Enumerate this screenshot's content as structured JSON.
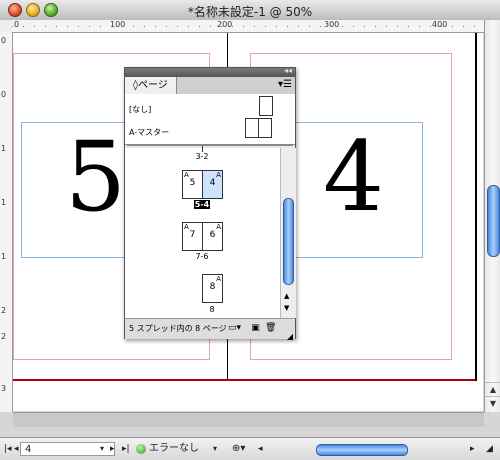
{
  "window": {
    "title": "*名称未設定-1 @ 50%"
  },
  "rulers": {
    "top_labels": [
      "0",
      "100",
      "200",
      "300",
      "400"
    ],
    "left_labels": [
      "0",
      "0",
      "1",
      "1",
      "1",
      "2",
      "2",
      "3"
    ]
  },
  "document": {
    "left_page_number": "5",
    "right_page_number": "4"
  },
  "pages_panel": {
    "tab_label": "◊ページ",
    "masters": [
      {
        "label": "[なし]"
      },
      {
        "label": "A-マスター"
      }
    ],
    "spreads": [
      {
        "label": "3-2",
        "pages": []
      },
      {
        "label": "5-4",
        "pages": [
          {
            "master": "A",
            "number": "5"
          },
          {
            "master": "A",
            "number": "4"
          }
        ]
      },
      {
        "label": "7-6",
        "pages": [
          {
            "master": "A",
            "number": "7"
          },
          {
            "master": "A",
            "number": "6"
          }
        ]
      },
      {
        "label": "8",
        "pages": [
          {
            "master": "A",
            "number": "8"
          }
        ]
      }
    ],
    "footer_text": "5 スプレッド内の 8 ページ"
  },
  "statusbar": {
    "page_field": "4",
    "error_status": "エラーなし"
  }
}
